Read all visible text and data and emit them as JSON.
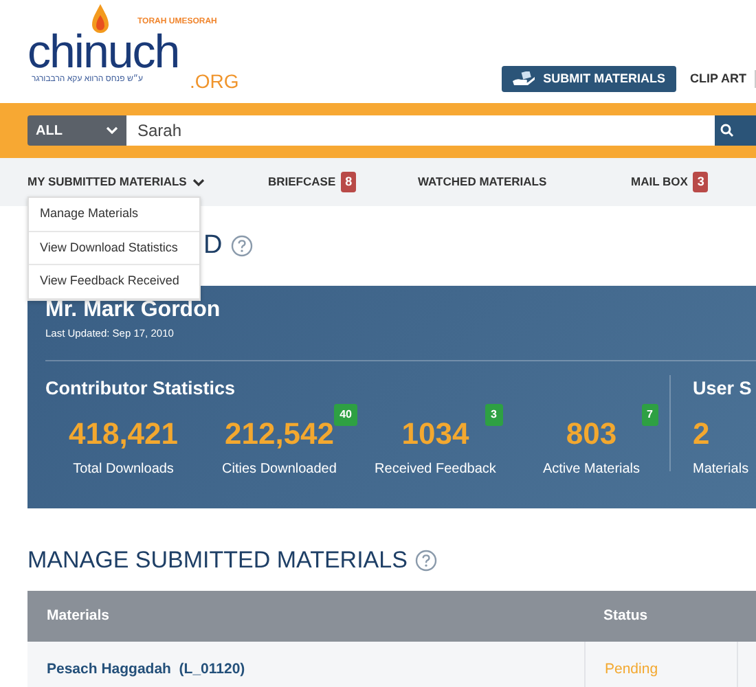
{
  "logo": {
    "tagline": "TORAH UMESORAH",
    "name": "chinuch",
    "domain": ".ORG",
    "dedication": "ע״ש פנחס הרווא עקא הרבבורגר"
  },
  "header_links": [
    {
      "kind": "button",
      "label": "SUBMIT MATERIALS"
    },
    {
      "kind": "link",
      "label": "CLIP ART"
    }
  ],
  "search": {
    "category": "ALL",
    "value": "Sarah"
  },
  "nav": [
    {
      "label": "MY SUBMITTED MATERIALS",
      "expanded": true
    },
    {
      "label": "BRIEFCASE",
      "badge": "8"
    },
    {
      "label": "WATCHED MATERIALS"
    },
    {
      "label": "MAIL BOX",
      "badge": "3"
    }
  ],
  "dropdown": [
    "Manage Materials",
    "View Download Statistics",
    "View Feedback Received"
  ],
  "page_heading": "D",
  "profile": {
    "name": "Mr. Mark Gordon",
    "updated": "Last Updated: Sep 17, 2010",
    "contributor_title": "Contributor Statistics",
    "stats": [
      {
        "value": "418,421",
        "label": "Total Downloads"
      },
      {
        "value": "212,542",
        "label": "Cities Downloaded",
        "badge": "40"
      },
      {
        "value": "1034",
        "label": "Received Feedback",
        "badge": "3"
      },
      {
        "value": "803",
        "label": "Active Materials",
        "badge": "7"
      }
    ],
    "user_title": "User S",
    "user_value": "2",
    "user_label": "Materials"
  },
  "section_title": "MANAGE SUBMITTED MATERIALS",
  "table": {
    "columns": [
      "Materials",
      "Status"
    ],
    "rows": [
      {
        "material": "Pesach Haggadah  (L_01120)",
        "status": "Pending"
      }
    ]
  }
}
